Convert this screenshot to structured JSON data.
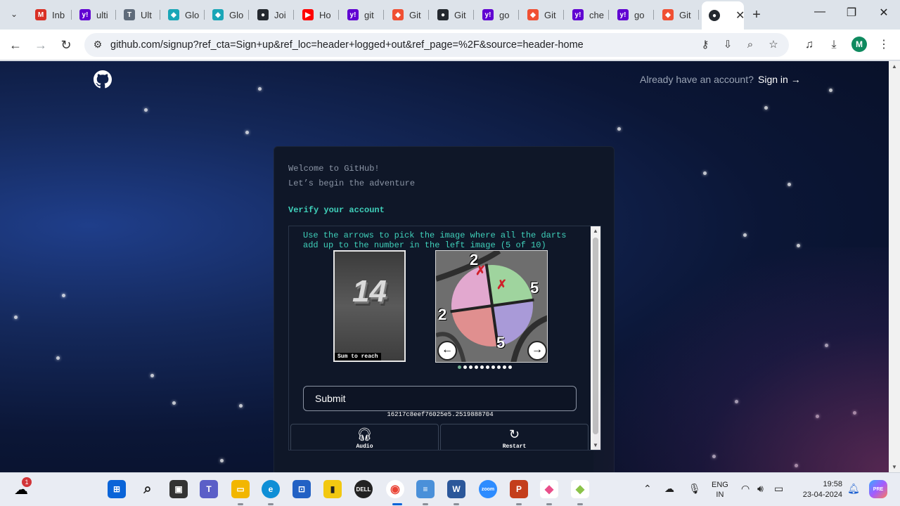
{
  "browser": {
    "tabs": [
      {
        "label": "Inb",
        "icon": "gmail-icon",
        "color": "#d93025",
        "glyph": "M"
      },
      {
        "label": "ulti",
        "icon": "yahoo-icon",
        "color": "#6001d2",
        "glyph": "y!"
      },
      {
        "label": "Ult",
        "icon": "tata-icon",
        "color": "#5f6b7a",
        "glyph": "T"
      },
      {
        "label": "Glo",
        "icon": "globe-icon",
        "color": "#1aa6b7",
        "glyph": "◆"
      },
      {
        "label": "Glo",
        "icon": "globe-icon",
        "color": "#1aa6b7",
        "glyph": "◆"
      },
      {
        "label": "Joi",
        "icon": "github-icon",
        "color": "#24292f",
        "glyph": "●"
      },
      {
        "label": "Ho",
        "icon": "youtube-icon",
        "color": "#ff0000",
        "glyph": "▶"
      },
      {
        "label": "git",
        "icon": "yahoo-icon",
        "color": "#6001d2",
        "glyph": "y!"
      },
      {
        "label": "Git",
        "icon": "git-icon",
        "color": "#f05033",
        "glyph": "◆"
      },
      {
        "label": "Git",
        "icon": "github-icon",
        "color": "#24292f",
        "glyph": "●"
      },
      {
        "label": "go",
        "icon": "yahoo-icon",
        "color": "#6001d2",
        "glyph": "y!"
      },
      {
        "label": "Git",
        "icon": "git-icon",
        "color": "#f05033",
        "glyph": "◆"
      },
      {
        "label": "che",
        "icon": "yahoo-icon",
        "color": "#6001d2",
        "glyph": "y!"
      },
      {
        "label": "go",
        "icon": "yahoo-icon",
        "color": "#6001d2",
        "glyph": "y!"
      },
      {
        "label": "Git",
        "icon": "git-icon",
        "color": "#f05033",
        "glyph": "◆"
      }
    ],
    "url": "github.com/signup?ref_cta=Sign+up&ref_loc=header+logged+out&ref_page=%2F&source=header-home",
    "profile_initial": "M"
  },
  "header": {
    "have_account": "Already have an account?",
    "sign_in": "Sign in →"
  },
  "card": {
    "welcome": "Welcome to GitHub!",
    "adventure": "Let’s begin the adventure",
    "verify_title": "Verify your account"
  },
  "captcha": {
    "instruction": "Use the arrows to pick the image where all the darts add up to the number in the left image (5 of 10)",
    "target_number": "14",
    "sum_label": "Sum to reach",
    "dart_numbers": [
      "2",
      "5",
      "2",
      "5"
    ],
    "dots_total": 10,
    "dots_active_index": 0,
    "submit_label": "Submit",
    "session_hash": "16217c8eef76025e5.2519888704",
    "audio_label": "Audio",
    "restart_label": "Restart"
  },
  "taskbar": {
    "notification_count": "1",
    "language": "ENG",
    "region": "IN",
    "time": "19:58",
    "date": "23-04-2024"
  },
  "colors": {
    "accent_teal": "#3fd0ba",
    "card_bg": "#0f1728"
  }
}
